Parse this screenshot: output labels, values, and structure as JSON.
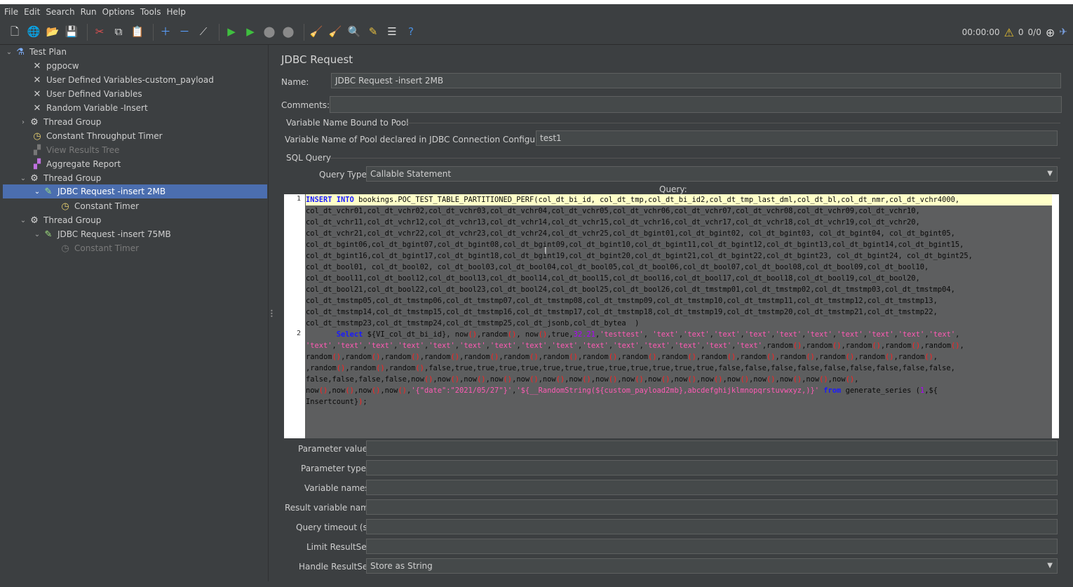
{
  "menu": [
    "File",
    "Edit",
    "Search",
    "Run",
    "Options",
    "Tools",
    "Help"
  ],
  "toolbar": {
    "timer": "00:00:00",
    "warnings": "0",
    "threads": "0/0"
  },
  "tree": {
    "items": [
      {
        "label": "Test Plan"
      },
      {
        "label": "pgpocw"
      },
      {
        "label": "User Defined Variables-custom_payload"
      },
      {
        "label": "User Defined Variables"
      },
      {
        "label": "Random Variable -Insert"
      },
      {
        "label": "Thread Group"
      },
      {
        "label": "Constant Throughput Timer"
      },
      {
        "label": "View Results Tree"
      },
      {
        "label": "Aggregate Report"
      },
      {
        "label": "Thread Group"
      },
      {
        "label": "JDBC Request -insert 2MB"
      },
      {
        "label": "Constant Timer"
      },
      {
        "label": "Thread Group"
      },
      {
        "label": "JDBC Request -insert 75MB"
      },
      {
        "label": "Constant Timer"
      }
    ]
  },
  "panel": {
    "title": "JDBC Request",
    "name_label": "Name:",
    "name_value": "JDBC Request -insert 2MB",
    "comments_label": "Comments:",
    "comments_value": "",
    "pool_section": "Variable Name Bound to Pool",
    "pool_label": "Variable Name of Pool declared in JDBC Connection Configuration:",
    "pool_value": "test1",
    "sql_section": "SQL Query",
    "query_type_label": "Query Type:",
    "query_type_value": "Callable Statement",
    "query_label": "Query:",
    "code_lines": [
      "col_dt_vchr01,col_dt_vchr02,col_dt_vchr03,col_dt_vchr04,col_dt_vchr05,col_dt_vchr06,col_dt_vchr07,col_dt_vchr08,col_dt_vchr09,col_dt_vchr10,",
      "col_dt_vchr11,col_dt_vchr12,col_dt_vchr13,col_dt_vchr14,col_dt_vchr15,col_dt_vchr16,col_dt_vchr17,col_dt_vchr18,col_dt_vchr19,col_dt_vchr20,",
      "col_dt_vchr21,col_dt_vchr22,col_dt_vchr23,col_dt_vchr24,col_dt_vchr25,col_dt_bgint01,col_dt_bgint02, col_dt_bgint03, col_dt_bgint04, col_dt_bgint05,",
      "col_dt_bgint06,col_dt_bgint07,col_dt_bgint08,col_dt_bgint09,col_dt_bgint10,col_dt_bgint11,col_dt_bgint12,col_dt_bgint13,col_dt_bgint14,col_dt_bgint15,",
      "col_dt_bgint16,col_dt_bgint17,col_dt_bgint18,col_dt_bgint19,col_dt_bgint20,col_dt_bgint21,col_dt_bgint22,col_dt_bgint23, col_dt_bgint24, col_dt_bgint25,",
      "col_dt_bool01, col_dt_bool02, col_dt_bool03,col_dt_bool04,col_dt_bool05,col_dt_bool06,col_dt_bool07,col_dt_bool08,col_dt_bool09,col_dt_bool10,",
      "col_dt_bool11,col_dt_bool12,col_dt_bool13,col_dt_bool14,col_dt_bool15,col_dt_bool16,col_dt_bool17,col_dt_bool18,col_dt_bool19,col_dt_bool20,",
      "col_dt_bool21,col_dt_bool22,col_dt_bool23,col_dt_bool24,col_dt_bool25,col_dt_bool26,col_dt_tmstmp01,col_dt_tmstmp02,col_dt_tmstmp03,col_dt_tmstmp04,",
      "col_dt_tmstmp05,col_dt_tmstmp06,col_dt_tmstmp07,col_dt_tmstmp08,col_dt_tmstmp09,col_dt_tmstmp10,col_dt_tmstmp11,col_dt_tmstmp12,col_dt_tmstmp13,",
      "col_dt_tmstmp14,col_dt_tmstmp15,col_dt_tmstmp16,col_dt_tmstmp17,col_dt_tmstmp18,col_dt_tmstmp19,col_dt_tmstmp20,col_dt_tmstmp21,col_dt_tmstmp22,",
      "col_dt_tmstmp23,col_dt_tmstmp24,col_dt_tmstmp25,col_dt_jsonb,col_dt_bytea  )"
    ],
    "params": [
      {
        "label": "Parameter values:",
        "value": ""
      },
      {
        "label": "Parameter types:",
        "value": ""
      },
      {
        "label": "Variable names:",
        "value": ""
      },
      {
        "label": "Result variable name:",
        "value": ""
      },
      {
        "label": "Query timeout (s):",
        "value": ""
      },
      {
        "label": "Limit ResultSet:",
        "value": ""
      }
    ],
    "handle_label": "Handle ResultSet:",
    "handle_value": "Store as String"
  },
  "colors": {
    "selection": "#4b6eaf",
    "keyword": "#1a1aff",
    "string": "#ff5ab4",
    "number": "#b000ff"
  }
}
